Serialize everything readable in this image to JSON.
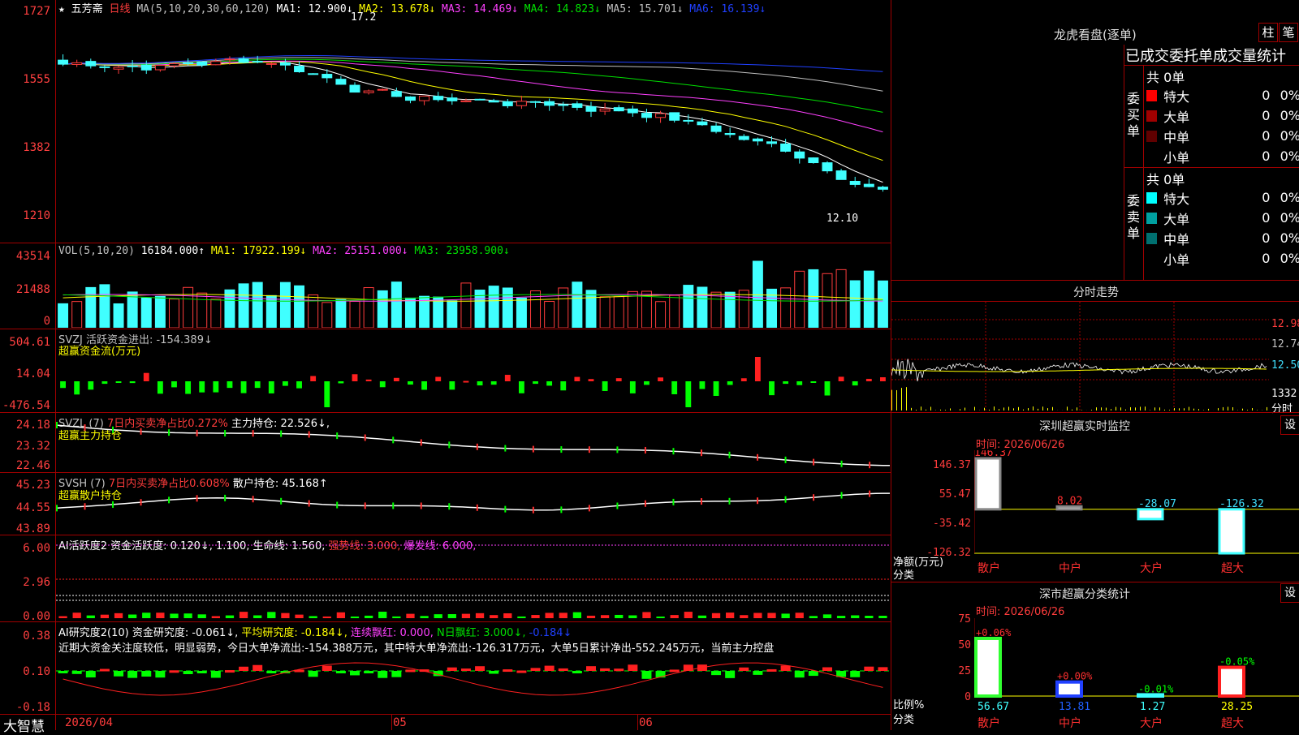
{
  "stock": {
    "name": "五芳斋",
    "period": "日线",
    "star": "★"
  },
  "ma_header": {
    "label": "MA(5,10,20,30,60,120)",
    "ma1": "MA1: 12.900↓",
    "ma2": "MA2: 13.678↓",
    "ma3": "MA3: 14.469↓",
    "ma4": "MA4: 14.823↓",
    "ma5": "MA5: 15.701↓",
    "ma6": "MA6: 16.139↓"
  },
  "price_axis": [
    "1727",
    "1555",
    "1382",
    "1210"
  ],
  "price_annot": {
    "high": "17.2",
    "low": "12.10"
  },
  "vol_header": {
    "label": "VOL(5,10,20)",
    "val": "16184.000↑",
    "ma1": "MA1: 17922.199↓",
    "ma2": "MA2: 25151.000↓",
    "ma3": "MA3: 23958.900↓"
  },
  "vol_axis": [
    "43514",
    "21488",
    "0"
  ],
  "svzj": {
    "l1": "SVZJ  活跃资金进出: -154.389↓",
    "l2": "超赢资金流(万元)",
    "axis": [
      "504.61",
      "14.04",
      "-476.54"
    ]
  },
  "svzl": {
    "l1a": "SVZL (7) ",
    "l1b": "7日内买卖净占比0.272%",
    "l1c": " 主力持仓: 22.526↓,",
    "l2": "超赢主力持仓",
    "axis": [
      "24.18",
      "23.32",
      "22.46"
    ]
  },
  "svsh": {
    "l1a": "SVSH (7) ",
    "l1b": "7日内买卖净占比0.608%",
    "l1c": " 散户持仓: 45.168↑",
    "l2": "超赢散户持仓",
    "axis": [
      "45.23",
      "44.55",
      "43.89"
    ]
  },
  "ai1": {
    "a": "AI活跃度2 资金活跃度: 0.120↓, 1.100, 生命线: 1.560, ",
    "b": "强势线: 3.000, ",
    "c": "爆发线: 6.000,",
    "axis": [
      "6.00",
      "2.96",
      "0.00"
    ]
  },
  "ai2": {
    "a": "AI研究度2(10) 资金研究度: -0.061↓, ",
    "b": "平均研究度: -0.184↓, ",
    "c": "连续飘红: 0.000, ",
    "d": "N日飘红: 3.000↓, ",
    "e": "-0.184↓",
    "text": "近期大资金关注度较低，明显弱势，今日大单净流出:-154.388万元，其中特大单净流出:-126.317万元，大单5日累计净出-552.245万元，当前主力控盘",
    "axis": [
      "0.38",
      "0.10",
      "-0.18"
    ]
  },
  "bottom": {
    "brand": "大智慧",
    "d1": "2026/04",
    "d2": "05",
    "d3": "06"
  },
  "dragon": {
    "title": "龙虎看盘(逐单)",
    "btn1": "柱",
    "btn2": "笔",
    "tab": "已成交委托单成交量统计",
    "buy": {
      "label": "委买单",
      "total": "共 0单",
      "rows": [
        {
          "name": "特大",
          "n": "0",
          "p": "0%",
          "c": "#ff0000"
        },
        {
          "name": "大单",
          "n": "0",
          "p": "0%",
          "c": "#a00000"
        },
        {
          "name": "中单",
          "n": "0",
          "p": "0%",
          "c": "#600000"
        },
        {
          "name": "小单",
          "n": "0",
          "p": "0%",
          "c": "#000000"
        }
      ]
    },
    "sell": {
      "label": "委卖单",
      "total": "共 0单",
      "rows": [
        {
          "name": "特大",
          "n": "0",
          "p": "0%",
          "c": "#00ffff"
        },
        {
          "name": "大单",
          "n": "0",
          "p": "0%",
          "c": "#00a0a0"
        },
        {
          "name": "中单",
          "n": "0",
          "p": "0%",
          "c": "#007070"
        },
        {
          "name": "小单",
          "n": "0",
          "p": "0%",
          "c": "#000000"
        }
      ]
    }
  },
  "intraday": {
    "title": "分时走势",
    "axis": [
      "12.98",
      "12.74",
      "12.50"
    ],
    "vol": "1332",
    "unit": "分时"
  },
  "monitor": {
    "title": "深圳超赢实时监控",
    "btn": "设",
    "time": "时间: 2026/06/26",
    "axis": [
      "146.37",
      "55.47",
      "-35.42",
      "-126.32"
    ],
    "ylabel": "净额(万元)",
    "xlabel": "分类",
    "cats": [
      "散户",
      "中户",
      "大户",
      "超大"
    ],
    "values": [
      "146.37",
      "8.02",
      "-28.07",
      "-126.32"
    ]
  },
  "classstat": {
    "title": "深市超赢分类统计",
    "btn": "设",
    "time": "时间: 2026/06/26",
    "axis": [
      "75",
      "50",
      "25",
      "0"
    ],
    "ylabel": "比例%",
    "xlabel": "分类",
    "cats": [
      "散户",
      "中户",
      "大户",
      "超大"
    ],
    "values": [
      "56.67",
      "13.81",
      "1.27",
      "28.25"
    ],
    "deltas": [
      "+0.06%",
      "+0.00%",
      "-0.01%",
      "-0.05%"
    ]
  },
  "colors": {
    "up": "#ff3c3c",
    "down": "#40ffff",
    "grid": "#a00000"
  }
}
